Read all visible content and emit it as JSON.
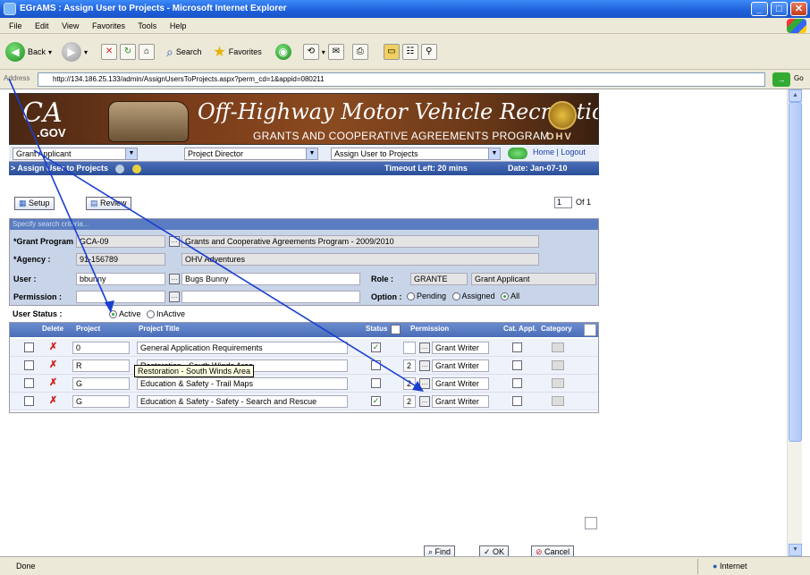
{
  "window": {
    "title": "EGrAMS : Assign User to Projects - Microsoft Internet Explorer",
    "controls": [
      "_",
      "□",
      "✕"
    ]
  },
  "menu": [
    "File",
    "Edit",
    "View",
    "Favorites",
    "Tools",
    "Help"
  ],
  "toolbar": {
    "back": "Back",
    "search": "Search",
    "favorites": "Favorites"
  },
  "address": {
    "label": "Address",
    "url": "http://134.186.25.133/admin/AssignUsersToProjects.aspx?perm_cd=1&appid=080211",
    "go": "Go"
  },
  "banner": {
    "ca": "CA",
    "gov": ".GOV",
    "title": "Off-Highway Motor Vehicle Recreation",
    "subtitle": "GRANTS AND COOPERATIVE AGREEMENTS PROGRAM",
    "ohv": "OHV"
  },
  "nav": {
    "role": "Grant Applicant",
    "sub": "Project Director",
    "task": "Assign User to Projects",
    "home": "Home | Logout"
  },
  "crumb": {
    "title": "> Assign User to Projects",
    "timeout": "Timeout Left: 20 mins",
    "date": "Date: Jan-07-10"
  },
  "actions": {
    "setup": "Setup",
    "review": "Review",
    "page": "1",
    "page_of": "Of 1"
  },
  "criteria": {
    "header": "Specify search criteria...",
    "grant_program_label": "*Grant Program :",
    "grant_program_code": "GCA-09",
    "grant_program_name": "Grants and Cooperative Agreements Program - 2009/2010",
    "agency_label": "*Agency :",
    "agency_code": "91-156789",
    "agency_name": "OHV Adventures",
    "user_label": "User :",
    "user_code": "bbunny",
    "user_name": "Bugs Bunny",
    "role_label": "Role :",
    "role_code": "GRANTE",
    "role_name": "Grant Applicant",
    "permission_label": "Permission :",
    "option_label": "Option :",
    "options": [
      "Pending",
      "Assigned",
      "All"
    ],
    "option_selected": "All"
  },
  "user_status": {
    "label": "User Status :",
    "options": [
      "Active",
      "InActive"
    ],
    "selected": "Active"
  },
  "grid": {
    "columns": [
      "Delete",
      "Project",
      "Project Title",
      "Status",
      "Permission",
      "Cat. Appl.",
      "Category"
    ],
    "rows": [
      {
        "project": "0",
        "title": "General Application Requirements",
        "status_checked": true,
        "perm_num": "",
        "permission": "Grant Writer"
      },
      {
        "project": "R",
        "title": "Restoration - South Winds Area",
        "status_checked": false,
        "perm_num": "2",
        "permission": "Grant Writer"
      },
      {
        "project": "G",
        "title": "Education & Safety - Trail Maps",
        "status_checked": false,
        "perm_num": "2",
        "permission": "Grant Writer"
      },
      {
        "project": "G",
        "title": "Education & Safety - Safety - Search and Rescue",
        "status_checked": true,
        "perm_num": "2",
        "permission": "Grant Writer"
      }
    ],
    "tooltip": "Restoration - South Winds Area"
  },
  "buttons": {
    "find": "Find",
    "ok": "OK",
    "cancel": "Cancel"
  },
  "status": {
    "left": "Done",
    "zone": "Internet"
  }
}
